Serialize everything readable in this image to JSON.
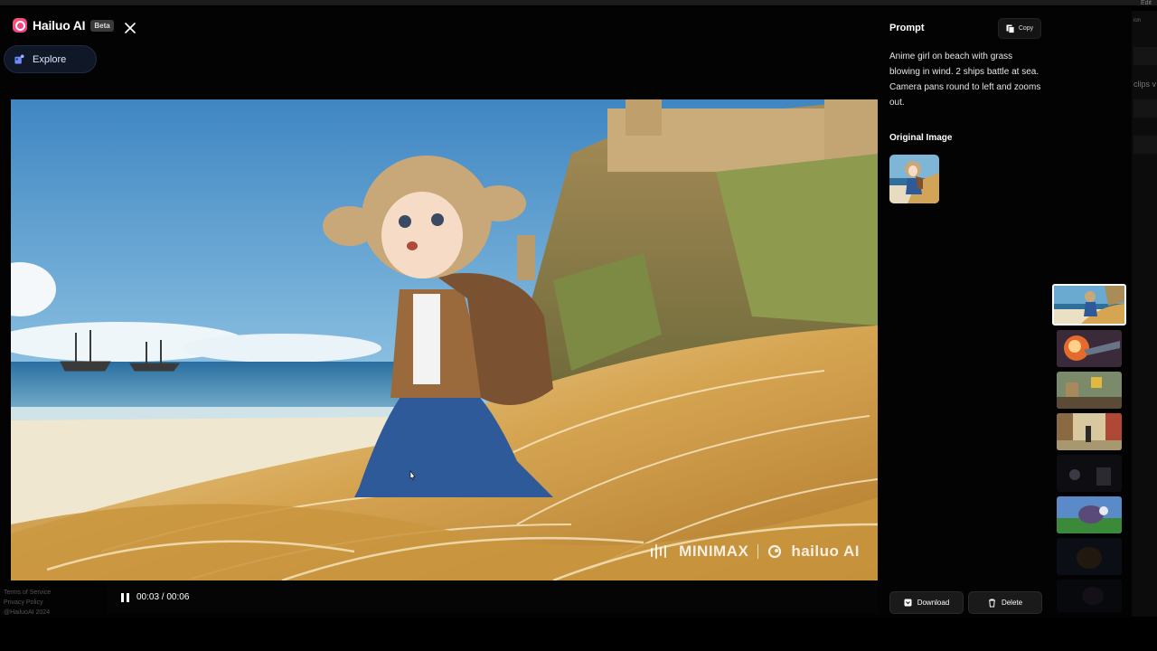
{
  "app": {
    "brand_name": "Hailuo AI",
    "beta_badge": "Beta",
    "close_icon": "close-icon",
    "explore_label": "Explore"
  },
  "background_app": {
    "top_right_label": "Edit",
    "side_text": "clips v",
    "side_text_small": "ion"
  },
  "video": {
    "watermark_left": "MINIMAX",
    "watermark_right": "hailuo AI",
    "time_display": "00:03 / 00:06",
    "playing": true
  },
  "footer": {
    "line1": "Terms of Service",
    "line2": "Privacy Policy",
    "line3": "@HailuoAI 2024"
  },
  "sidebar": {
    "prompt_heading": "Prompt",
    "copy_label": "Copy",
    "prompt_text": "Anime girl on beach with grass blowing in wind. 2 ships battle at sea. Camera pans round to left and zooms out.",
    "original_image_heading": "Original Image",
    "download_label": "Download",
    "delete_label": "Delete"
  },
  "thumbnails": [
    {
      "name": "thumb-anime-girl-beach",
      "selected": true
    },
    {
      "name": "thumb-spaceship-explosion",
      "selected": false
    },
    {
      "name": "thumb-cartoon-room",
      "selected": false
    },
    {
      "name": "thumb-street-walker",
      "selected": false
    },
    {
      "name": "thumb-dark-studio",
      "selected": false
    },
    {
      "name": "thumb-creature-grass",
      "selected": false
    },
    {
      "name": "thumb-dark-scene-1",
      "selected": false
    },
    {
      "name": "thumb-dark-scene-2",
      "selected": false
    }
  ],
  "colors": {
    "background": "#000000",
    "explore_bg": "#101828",
    "accent_pink": "#e8368f",
    "selected_border": "#ffffff"
  }
}
